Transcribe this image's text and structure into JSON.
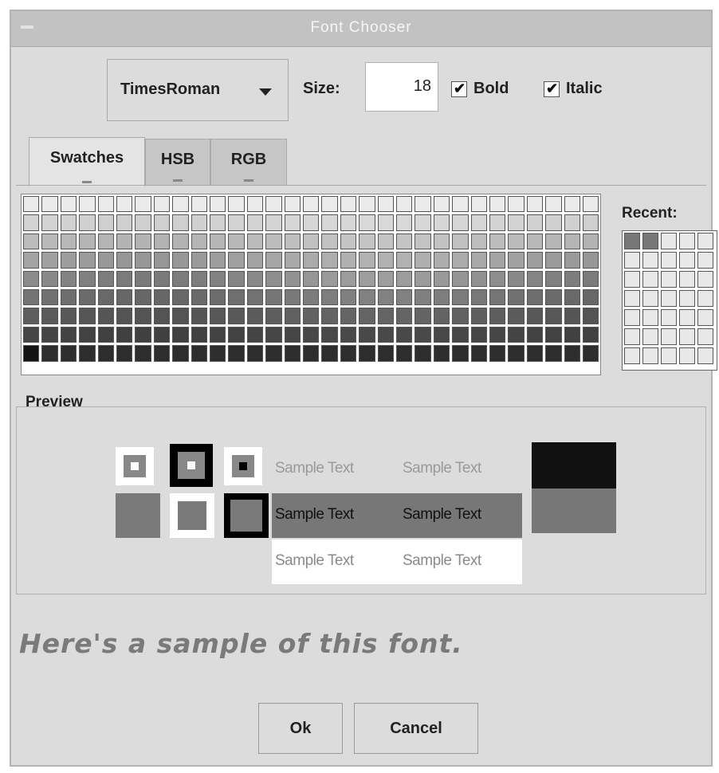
{
  "window": {
    "title": "Font Chooser"
  },
  "font": {
    "name": "TimesRoman",
    "size_label": "Size:",
    "size_value": "18"
  },
  "options": {
    "bold_label": "Bold",
    "bold_checked": true,
    "italic_label": "Italic",
    "italic_checked": true,
    "check_mark": "✔"
  },
  "tabs": [
    {
      "label": "Swatches"
    },
    {
      "label": "HSB"
    },
    {
      "label": "RGB"
    }
  ],
  "recent": {
    "label": "Recent:"
  },
  "preview": {
    "label": "Preview",
    "rows": [
      {
        "text1": "Sample Text",
        "text2": "Sample Text"
      },
      {
        "text1": "Sample Text",
        "text2": "Sample Text"
      },
      {
        "text1": "Sample Text",
        "text2": "Sample Text"
      }
    ]
  },
  "sample_text": "Here's a sample of this font.",
  "buttons": {
    "ok": "Ok",
    "cancel": "Cancel"
  },
  "colors": {
    "dialog_bg": "#dcdcdc",
    "title_bar": "#c2c2c2",
    "selected_color": "#777777",
    "preview_dark": "#111111"
  }
}
